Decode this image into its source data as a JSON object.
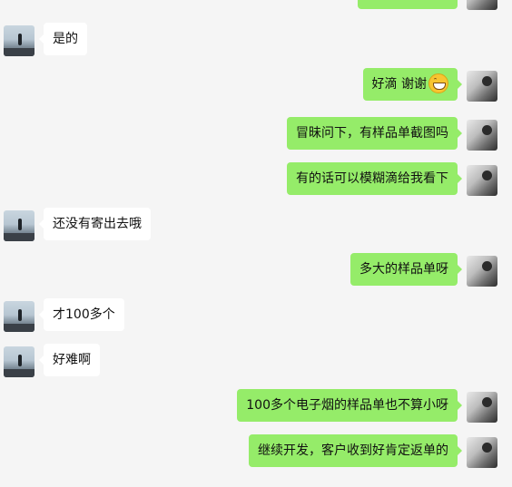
{
  "messages": [
    {
      "side": "right",
      "text": "",
      "partial": true
    },
    {
      "side": "left",
      "text": "是的"
    },
    {
      "side": "right",
      "text": "好滴 谢谢",
      "emoji": "grin-emoji"
    },
    {
      "side": "right",
      "text": "冒昧问下，有样品单截图吗"
    },
    {
      "side": "right",
      "text": "有的话可以模糊滴给我看下"
    },
    {
      "side": "left",
      "text": "还没有寄出去哦"
    },
    {
      "side": "right",
      "text": "多大的样品单呀"
    },
    {
      "side": "left",
      "text": "才100多个"
    },
    {
      "side": "left",
      "text": "好难啊"
    },
    {
      "side": "right",
      "text": "100多个电子烟的样品单也不算小呀"
    },
    {
      "side": "right",
      "text": "继续开发，客户收到好肯定返单的"
    }
  ],
  "colors": {
    "outgoing_bubble": "#95ec69",
    "incoming_bubble": "#ffffff",
    "background": "#f5f5f5"
  }
}
